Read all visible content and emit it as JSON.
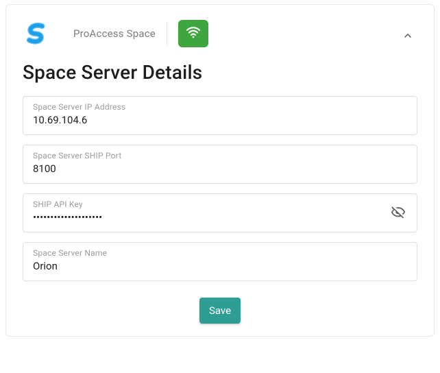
{
  "header": {
    "product_name": "ProAccess Space"
  },
  "section": {
    "title": "Space Server Details"
  },
  "fields": {
    "ip": {
      "label": "Space Server IP Address",
      "value": "10.69.104.6"
    },
    "port": {
      "label": "Space Server SHIP Port",
      "value": "8100"
    },
    "apikey": {
      "label": "SHIP API Key",
      "value": "••••••••••••••••••••"
    },
    "servername": {
      "label": "Space Server Name",
      "value": "Orion"
    }
  },
  "actions": {
    "save_label": "Save"
  },
  "colors": {
    "accent_green": "#3fa63f",
    "save_teal": "#2e9e94",
    "logo_light": "#6ec5f6",
    "logo_dark": "#1e9fe8"
  }
}
